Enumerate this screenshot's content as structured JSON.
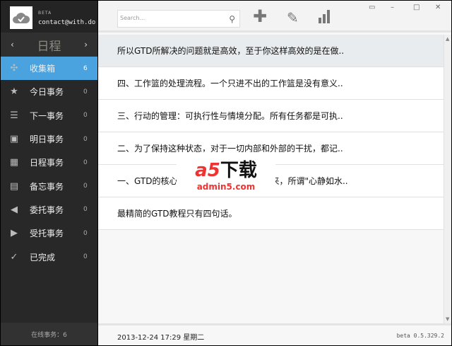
{
  "sidebar": {
    "beta": "BETA",
    "email": "contact@with.do",
    "calendar_title": "日程",
    "prev": "‹",
    "next": "›",
    "items": [
      {
        "label": "收集箱",
        "count": "6",
        "icon": "puzzle-icon",
        "glyph": "✣"
      },
      {
        "label": "今日事务",
        "count": "0",
        "icon": "star-icon",
        "glyph": "★"
      },
      {
        "label": "下一事务",
        "count": "0",
        "icon": "list-icon",
        "glyph": "☰"
      },
      {
        "label": "明日事务",
        "count": "0",
        "icon": "calendar-next-icon",
        "glyph": "▣"
      },
      {
        "label": "日程事务",
        "count": "0",
        "icon": "calendar-icon",
        "glyph": "▦"
      },
      {
        "label": "备忘事务",
        "count": "0",
        "icon": "memo-icon",
        "glyph": "▤"
      },
      {
        "label": "委托事务",
        "count": "0",
        "icon": "send-icon",
        "glyph": "◀"
      },
      {
        "label": "受托事务",
        "count": "0",
        "icon": "receive-icon",
        "glyph": "▶"
      },
      {
        "label": "已完成",
        "count": "0",
        "icon": "check-icon",
        "glyph": "✓"
      }
    ],
    "online": "在线事务：6"
  },
  "toolbar": {
    "search_placeholder": "Search..."
  },
  "tasks": [
    "所以GTD所解决的问题就是高效，至于你这样高效的是在做..",
    "四、工作篮的处理流程。一个只进不出的工作篮是没有意义..",
    "三、行动的管理：可执行性与情境分配。所有任务都是可执..",
    "二、为了保持这种状态，对于一切内部和外部的干扰，都记..",
    "一、GTD的核心理念概括就是必须记录下来，所谓\"心静如水..",
    "最精简的GTD教程只有四句话。"
  ],
  "footer": {
    "datetime": "2013-12-24 17:29 星期二",
    "version": "beta 0.5.329.2"
  },
  "watermark": {
    "brand": "a5下载",
    "site": "admin5.com"
  }
}
